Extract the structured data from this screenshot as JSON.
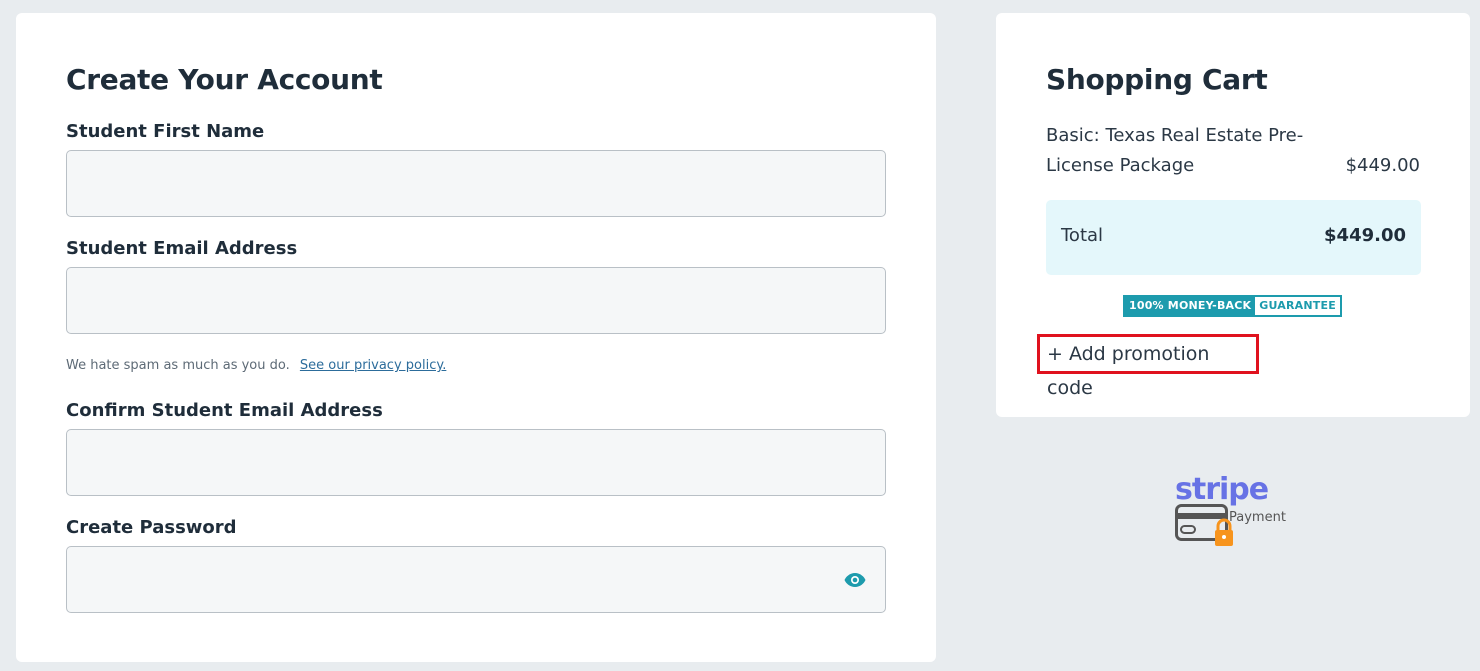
{
  "account": {
    "title": "Create Your Account",
    "first_name_label": "Student First Name",
    "first_name_value": "",
    "email_label": "Student Email Address",
    "email_value": "",
    "spam_note": "We hate spam as much as you do.",
    "privacy_link": "See our privacy policy.",
    "confirm_email_label": "Confirm Student Email Address",
    "confirm_email_value": "",
    "password_label": "Create Password",
    "password_value": ""
  },
  "cart": {
    "title": "Shopping Cart",
    "item_name": "Basic: Texas Real Estate Pre-License Package",
    "item_price": "$449.00",
    "total_label": "Total",
    "total_value": "$449.00",
    "badge_left": "100% MONEY-BACK",
    "badge_right": "GUARANTEE",
    "promo_link": "+ Add promotion code"
  },
  "stripe": {
    "word": "stripe",
    "caption": "Payment"
  },
  "colors": {
    "accent_teal": "#1d9bad",
    "promo_highlight": "#e0121e",
    "stripe_brand": "#6772e5"
  }
}
